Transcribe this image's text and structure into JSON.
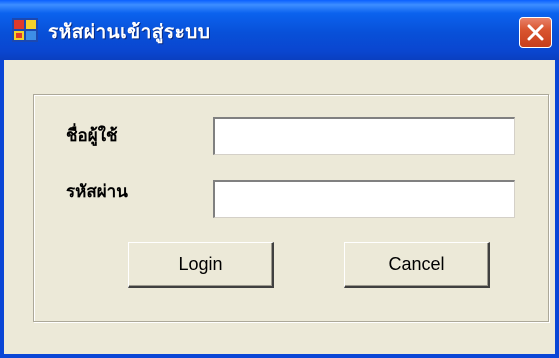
{
  "window": {
    "title": "รหัสผ่านเข้าสู่ระบบ",
    "close_label": "Close"
  },
  "form": {
    "username_label": "ชื่อผู้ใช้",
    "username_value": "",
    "password_label": "รหัสผ่าน",
    "password_value": ""
  },
  "buttons": {
    "login_label": "Login",
    "cancel_label": "Cancel"
  },
  "icons": {
    "app": "app-window-icon",
    "close": "close-x-icon"
  },
  "colors": {
    "titlebar": "#0a5fff",
    "window_bg": "#ece9d8",
    "close_button": "#d9552f"
  }
}
